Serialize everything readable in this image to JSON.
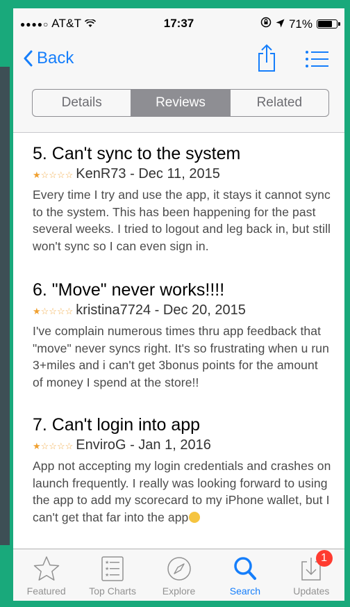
{
  "status_bar": {
    "carrier": "AT&T",
    "time": "17:37",
    "battery": "71%"
  },
  "nav": {
    "back_label": "Back"
  },
  "segments": [
    {
      "label": "Details",
      "active": false
    },
    {
      "label": "Reviews",
      "active": true
    },
    {
      "label": "Related",
      "active": false
    }
  ],
  "reviews": [
    {
      "title": "5. Can't sync to the system",
      "rating": 1,
      "author_date": "KenR73 - Dec 11, 2015",
      "body": "Every time I try and use the app, it stays it cannot sync to the system. This has been happening for the past several weeks.  I tried to logout and leg back in, but still won't sync so I can even sign in."
    },
    {
      "title": "6. \"Move\" never works!!!!",
      "rating": 1,
      "author_date": "kristina7724 - Dec 20, 2015",
      "body": "I've complain numerous times thru app feedback that \"move\" never syncs right. It's so frustrating when u run 3+miles and i can't get 3bonus points for the amount of money I spend at the store!!"
    },
    {
      "title": "7. Can't login into app",
      "rating": 1,
      "author_date": "EnviroG - Jan 1, 2016",
      "body": "App not accepting my login credentials and crashes on launch frequently. I really was looking forward to using the app to add my scorecard to my iPhone wallet, but I can't get that far into the app"
    }
  ],
  "tabbar": [
    {
      "label": "Featured",
      "icon": "star-icon",
      "active": false
    },
    {
      "label": "Top Charts",
      "icon": "top-charts-icon",
      "active": false
    },
    {
      "label": "Explore",
      "icon": "compass-icon",
      "active": false
    },
    {
      "label": "Search",
      "icon": "search-icon",
      "active": true
    },
    {
      "label": "Updates",
      "icon": "updates-icon",
      "active": false,
      "badge": "1"
    }
  ],
  "colors": {
    "accent": "#157efb",
    "frame": "#19a97b",
    "star": "#f0a030",
    "badge": "#ff3b30"
  }
}
